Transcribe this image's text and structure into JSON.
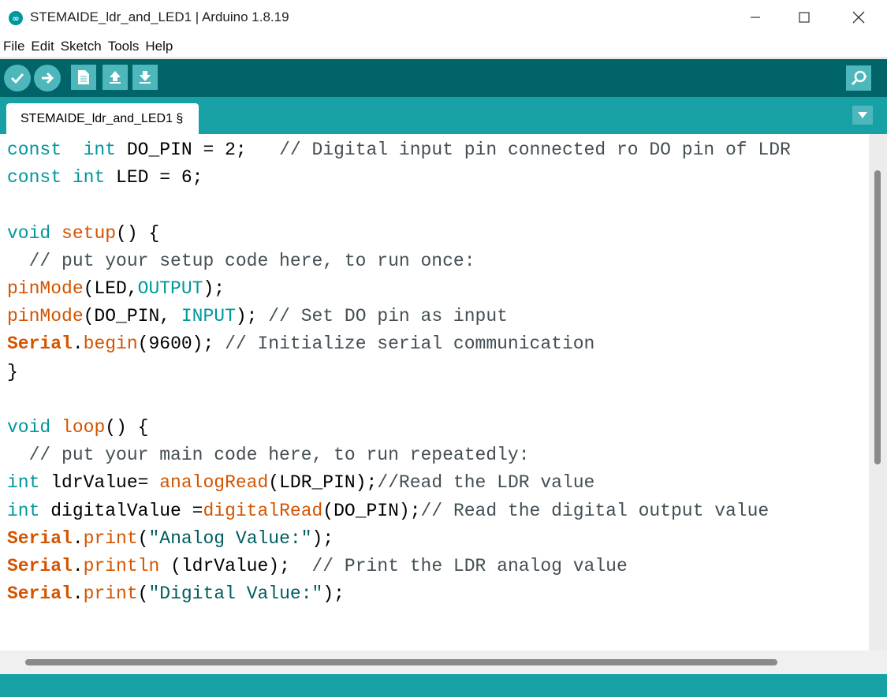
{
  "window": {
    "title": "STEMAIDE_ldr_and_LED1 | Arduino 1.8.19",
    "logo_text": "∞",
    "minimize": "—",
    "maximize": "☐",
    "close": "✕"
  },
  "menu": [
    "File",
    "Edit",
    "Sketch",
    "Tools",
    "Help"
  ],
  "toolbar": {
    "buttons": [
      "verify-icon",
      "upload-icon",
      "new-icon",
      "open-icon",
      "save-icon"
    ],
    "serial_monitor": "serial-monitor-icon"
  },
  "tabs": [
    {
      "label": "STEMAIDE_ldr_and_LED1 §"
    }
  ],
  "colors": {
    "toolbar": "#006468",
    "tabbar": "#17a1a5",
    "button": "#4db7bb",
    "keyword": "#00979c",
    "function": "#d35400",
    "comment": "#434f54"
  },
  "code": [
    [
      [
        "c-type",
        "const"
      ],
      [
        "",
        "  "
      ],
      [
        "c-type",
        "int"
      ],
      [
        "",
        " DO_PIN = 2;   "
      ],
      [
        "c-comment",
        "// Digital input pin connected ro DO pin of LDR"
      ]
    ],
    [
      [
        "c-type",
        "const"
      ],
      [
        "",
        " "
      ],
      [
        "c-type",
        "int"
      ],
      [
        "",
        " LED = 6;"
      ]
    ],
    [],
    [
      [
        "c-type",
        "void"
      ],
      [
        "",
        " "
      ],
      [
        "c-func",
        "setup"
      ],
      [
        "",
        "() {"
      ]
    ],
    [
      [
        "",
        "  "
      ],
      [
        "c-comment",
        "// put your setup code here, to run once:"
      ]
    ],
    [
      [
        "c-func",
        "pinMode"
      ],
      [
        "",
        "(LED,"
      ],
      [
        "c-const",
        "OUTPUT"
      ],
      [
        "",
        ");"
      ]
    ],
    [
      [
        "c-func",
        "pinMode"
      ],
      [
        "",
        "(DO_PIN, "
      ],
      [
        "c-const",
        "INPUT"
      ],
      [
        "",
        "); "
      ],
      [
        "c-comment",
        "// Set DO pin as input"
      ]
    ],
    [
      [
        "c-serial",
        "Serial"
      ],
      [
        "",
        "."
      ],
      [
        "c-func",
        "begin"
      ],
      [
        "",
        "(9600); "
      ],
      [
        "c-comment",
        "// Initialize serial communication"
      ]
    ],
    [
      [
        "",
        "}"
      ]
    ],
    [],
    [
      [
        "c-type",
        "void"
      ],
      [
        "",
        " "
      ],
      [
        "c-func",
        "loop"
      ],
      [
        "",
        "() {"
      ]
    ],
    [
      [
        "",
        "  "
      ],
      [
        "c-comment",
        "// put your main code here, to run repeatedly:"
      ]
    ],
    [
      [
        "c-type",
        "int"
      ],
      [
        "",
        " ldrValue= "
      ],
      [
        "c-func",
        "analogRead"
      ],
      [
        "",
        "(LDR_PIN);"
      ],
      [
        "c-comment",
        "//Read the LDR value"
      ]
    ],
    [
      [
        "c-type",
        "int"
      ],
      [
        "",
        " digitalValue ="
      ],
      [
        "c-func",
        "digitalRead"
      ],
      [
        "",
        "(DO_PIN);"
      ],
      [
        "c-comment",
        "// Read the digital output value"
      ]
    ],
    [
      [
        "c-serial",
        "Serial"
      ],
      [
        "",
        "."
      ],
      [
        "c-func",
        "print"
      ],
      [
        "",
        "("
      ],
      [
        "c-str",
        "\"Analog Value:\""
      ],
      [
        "",
        ");"
      ]
    ],
    [
      [
        "c-serial",
        "Serial"
      ],
      [
        "",
        "."
      ],
      [
        "c-func",
        "println"
      ],
      [
        "",
        " (ldrValue);  "
      ],
      [
        "c-comment",
        "// Print the LDR analog value"
      ]
    ],
    [
      [
        "c-serial",
        "Serial"
      ],
      [
        "",
        "."
      ],
      [
        "c-func",
        "print"
      ],
      [
        "",
        "("
      ],
      [
        "c-str",
        "\"Digital Value:\""
      ],
      [
        "",
        ");"
      ]
    ]
  ]
}
